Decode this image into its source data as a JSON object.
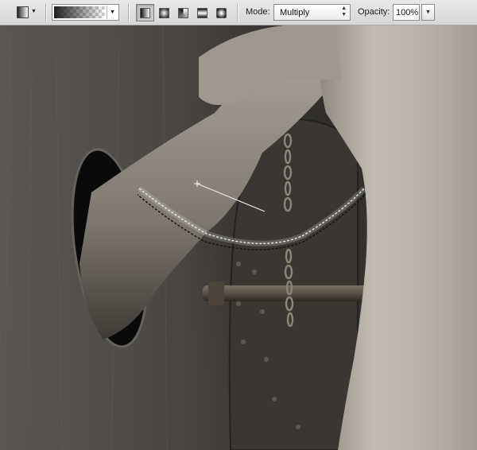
{
  "options_bar": {
    "tool_preset_icon": "gradient-tool-icon",
    "gradient_picker_icon": "gradient-swatch-icon",
    "gradient_types": [
      {
        "name": "linear",
        "icon": "linear-gradient-icon",
        "active": true
      },
      {
        "name": "radial",
        "icon": "radial-gradient-icon",
        "active": false
      },
      {
        "name": "angle",
        "icon": "angle-gradient-icon",
        "active": false
      },
      {
        "name": "reflected",
        "icon": "reflected-gradient-icon",
        "active": false
      },
      {
        "name": "diamond",
        "icon": "diamond-gradient-icon",
        "active": false
      }
    ],
    "mode_label": "Mode:",
    "mode_value": "Multiply",
    "opacity_label": "Opacity:",
    "opacity_value": "100%"
  },
  "canvas": {
    "description_icon": "photo-canvas",
    "gradient_drag_line": "gradient-drag-line",
    "selection": "marching-ants-selection"
  },
  "colors": {
    "toolbar_bg": "#dedede",
    "skin": "#b9b3a7",
    "wall": "#4a4744"
  }
}
